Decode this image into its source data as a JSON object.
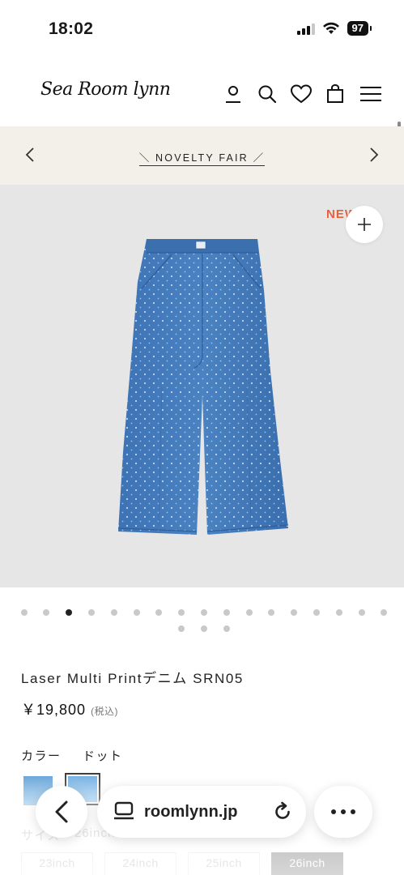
{
  "status_bar": {
    "time": "18:02",
    "battery": "97",
    "icons": [
      "cellular-signal-icon",
      "wifi-icon",
      "battery-icon"
    ]
  },
  "header": {
    "logo": "Sea Room lynn",
    "icons": [
      "account-icon",
      "search-icon",
      "heart-icon",
      "shopping-bag-icon",
      "menu-icon"
    ]
  },
  "banner": {
    "text": "＼ NOVELTY FAIR ／",
    "background": "#f3f0ea"
  },
  "product_image": {
    "badge": "NEW",
    "badge_color": "#e8603a",
    "background": "#e6e6e6",
    "carousel_total": 20,
    "carousel_active": 3
  },
  "product": {
    "name": "Laser Multi Printデニム SRN05",
    "price": "￥19,800",
    "tax_note": "(税込)",
    "color_label": "カラー",
    "color_value": "ドット",
    "swatch_colors": [
      "#6aa8dd",
      "#7cb7e6"
    ],
    "size_label": "サイズ",
    "size_value": "26inch",
    "sizes": [
      "23inch",
      "24inch",
      "25inch",
      "26inch"
    ],
    "selected_size": "26inch"
  },
  "browser_bar": {
    "url": "roomlynn.jp",
    "icons": [
      "back-chevron-icon",
      "reader-icon",
      "reload-icon",
      "more-icon"
    ]
  }
}
